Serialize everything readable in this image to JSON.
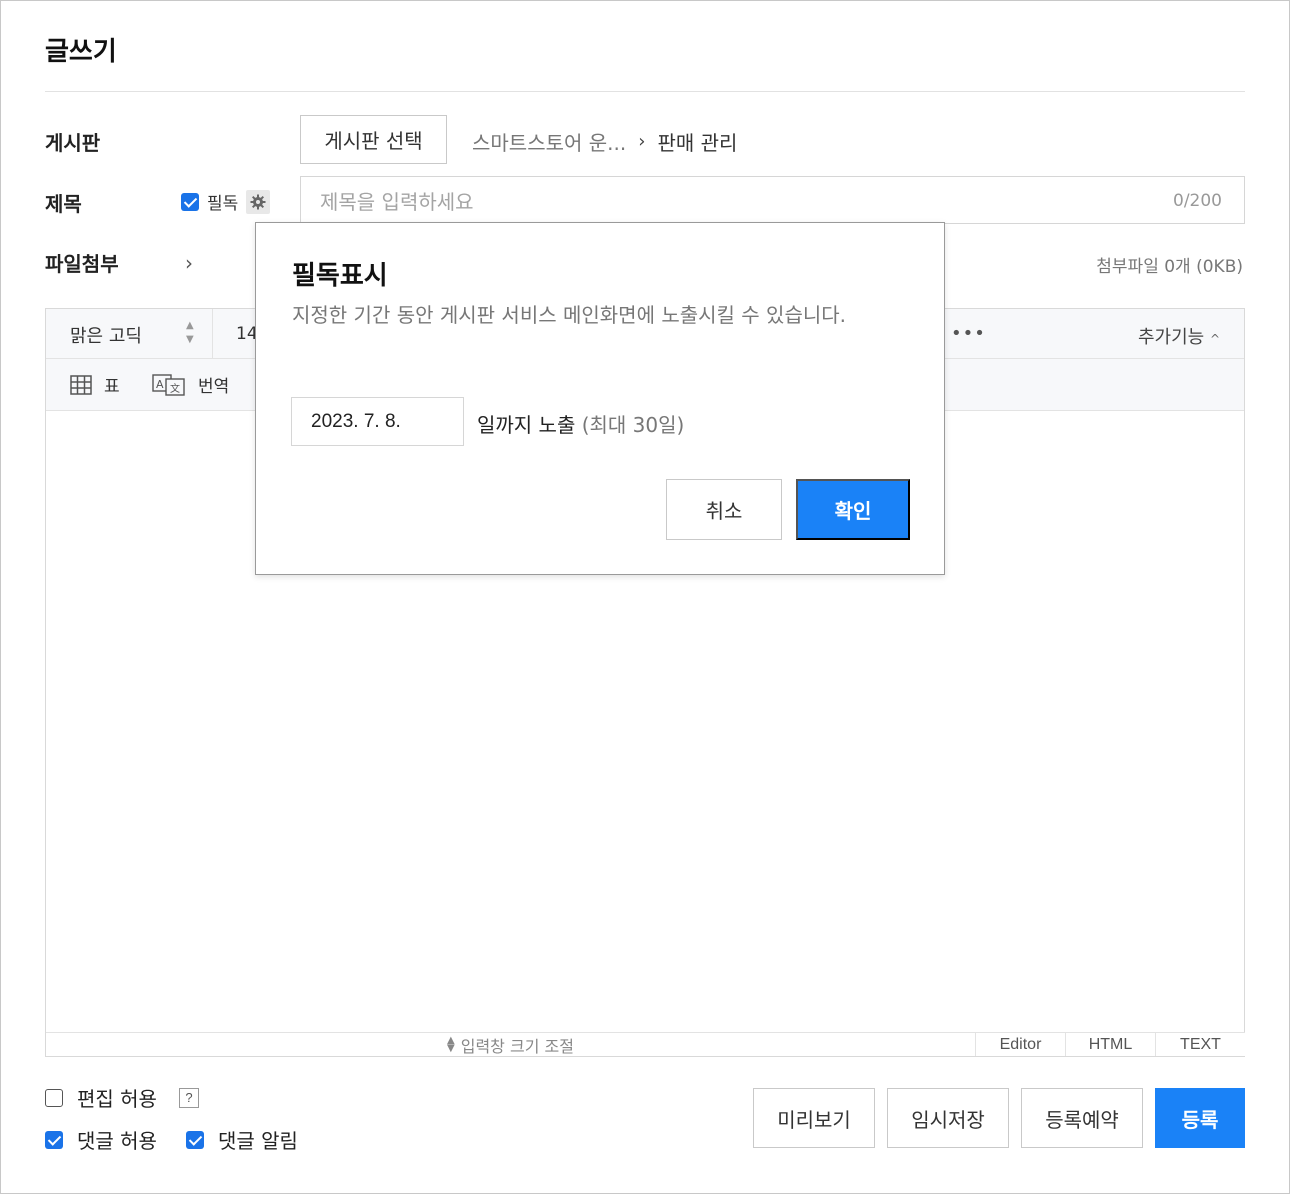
{
  "page": {
    "title": "글쓰기"
  },
  "board": {
    "label": "게시판",
    "select_button": "게시판 선택",
    "breadcrumb_parent": "스마트스토어 운...",
    "breadcrumb_current": "판매 관리"
  },
  "subject": {
    "label": "제목",
    "pin_label": "필독",
    "pin_checked": true,
    "placeholder": "제목을 입력하세요",
    "counter": "0/200"
  },
  "attachment": {
    "label": "파일첨부",
    "info": "첨부파일 0개 (0KB)"
  },
  "editor": {
    "font_family": "맑은 고딕",
    "font_size": "14",
    "more_icon": "more-horizontal-icon",
    "extra_features": "추가기능",
    "tools": [
      {
        "icon": "table-icon",
        "label": "표"
      },
      {
        "icon": "translate-icon",
        "label": "번역"
      }
    ],
    "resize_label": "입력창 크기 조절",
    "modes": [
      "Editor",
      "HTML",
      "TEXT"
    ],
    "active_mode": "Editor"
  },
  "options": {
    "allow_edit": {
      "label": "편집 허용",
      "checked": false,
      "help": "?"
    },
    "allow_comments": {
      "label": "댓글 허용",
      "checked": true
    },
    "comment_alert": {
      "label": "댓글 알림",
      "checked": true
    }
  },
  "actions": {
    "preview": "미리보기",
    "draft": "임시저장",
    "schedule": "등록예약",
    "submit": "등록"
  },
  "modal": {
    "title": "필독표시",
    "description": "지정한 기간 동안 게시판 서비스 메인화면에 노출시킬 수 있습니다.",
    "date_value": "2023. 7. 8.",
    "date_suffix": "일까지 노출",
    "date_note": "(최대 30일)",
    "cancel": "취소",
    "confirm": "확인"
  },
  "colors": {
    "primary": "#1a82f7",
    "checkbox": "#1a73e8"
  }
}
